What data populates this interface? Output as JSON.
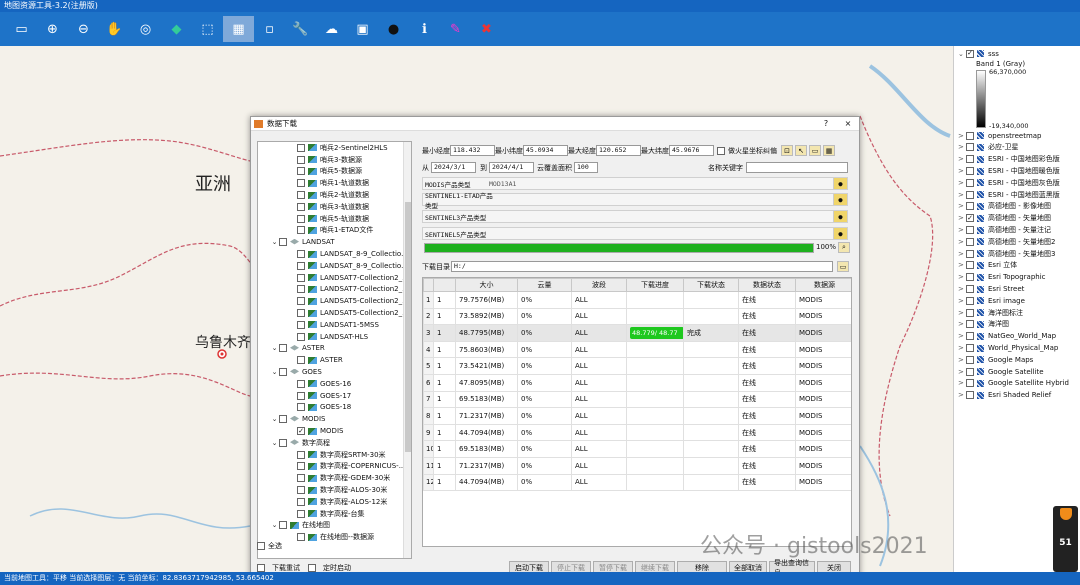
{
  "app": {
    "title": "地图资源工具-3.2(注册版)"
  },
  "toolbar": {
    "buttons": [
      "save",
      "zoom-in",
      "zoom-out",
      "pan",
      "zoom-extent",
      "navigate",
      "select-area",
      "grid",
      "clear",
      "tools",
      "cloud",
      "map",
      "user",
      "info",
      "edit",
      "close"
    ]
  },
  "map": {
    "labels": {
      "asia": "亚洲",
      "urumqi": "乌鲁木齐"
    }
  },
  "layers": {
    "items": [
      {
        "label": "sss",
        "checked": true,
        "expand": "⌄"
      },
      {
        "label": "openstreetmap",
        "checked": false,
        "expand": ">"
      },
      {
        "label": "必应-卫星",
        "checked": false,
        "expand": ">"
      },
      {
        "label": "ESRI - 中国地图彩色版",
        "checked": false,
        "expand": ">"
      },
      {
        "label": "ESRI - 中国地图暖色版",
        "checked": false,
        "expand": ">"
      },
      {
        "label": "ESRI - 中国地图灰色版",
        "checked": false,
        "expand": ">"
      },
      {
        "label": "ESRI - 中国地图蓝黑版",
        "checked": false,
        "expand": ">"
      },
      {
        "label": "高德地图 - 影像地图",
        "checked": false,
        "expand": ">"
      },
      {
        "label": "高德地图 - 矢量地图",
        "checked": true,
        "expand": ">"
      },
      {
        "label": "高德地图 - 矢量注记",
        "checked": false,
        "expand": ">"
      },
      {
        "label": "高德地图 - 矢量地图2",
        "checked": false,
        "expand": ">"
      },
      {
        "label": "高德地图 - 矢量地图3",
        "checked": false,
        "expand": ">"
      },
      {
        "label": "Esri 立体",
        "checked": false,
        "expand": ">"
      },
      {
        "label": "Esri Topographic",
        "checked": false,
        "expand": ">"
      },
      {
        "label": "Esri Street",
        "checked": false,
        "expand": ">"
      },
      {
        "label": "Esri image",
        "checked": false,
        "expand": ">"
      },
      {
        "label": "海洋图标注",
        "checked": false,
        "expand": ">"
      },
      {
        "label": "海洋图",
        "checked": false,
        "expand": ">"
      },
      {
        "label": "NatGeo_World_Map",
        "checked": false,
        "expand": ">"
      },
      {
        "label": "World_Physical_Map",
        "checked": false,
        "expand": ">"
      },
      {
        "label": "Google Maps",
        "checked": false,
        "expand": ">"
      },
      {
        "label": "Google Satellite",
        "checked": false,
        "expand": ">"
      },
      {
        "label": "Google Satellite Hybrid",
        "checked": false,
        "expand": ">"
      },
      {
        "label": "Esri Shaded Relief",
        "checked": false,
        "expand": ">"
      }
    ],
    "legend": {
      "band": "Band 1 (Gray)",
      "max": "66,370,000",
      "min": "-19,340,000"
    }
  },
  "dialog": {
    "title": "数据下载",
    "help": "?",
    "close": "×",
    "tree": [
      {
        "indent": 2,
        "chev": "",
        "icon": "leaf",
        "label": "哨兵2-Sentinel2HLS"
      },
      {
        "indent": 2,
        "chev": "",
        "icon": "leaf",
        "label": "哨兵3-数据源"
      },
      {
        "indent": 2,
        "chev": "",
        "icon": "leaf",
        "label": "哨兵5-数据源"
      },
      {
        "indent": 2,
        "chev": "",
        "icon": "leaf",
        "label": "哨兵1-轨道数据"
      },
      {
        "indent": 2,
        "chev": "",
        "icon": "leaf",
        "label": "哨兵2-轨道数据"
      },
      {
        "indent": 2,
        "chev": "",
        "icon": "leaf",
        "label": "哨兵3-轨道数据"
      },
      {
        "indent": 2,
        "chev": "",
        "icon": "leaf",
        "label": "哨兵5-轨道数据"
      },
      {
        "indent": 2,
        "chev": "",
        "icon": "leaf",
        "label": "哨兵1-ETAD文件"
      },
      {
        "indent": 1,
        "chev": "⌄",
        "icon": "folder",
        "label": "LANDSAT"
      },
      {
        "indent": 2,
        "chev": "",
        "icon": "leaf",
        "label": "LANDSAT_8-9_Collectio..."
      },
      {
        "indent": 2,
        "chev": "",
        "icon": "leaf",
        "label": "LANDSAT_8-9_Collectio..."
      },
      {
        "indent": 2,
        "chev": "",
        "icon": "leaf",
        "label": "LANDSAT7-Collection2_..."
      },
      {
        "indent": 2,
        "chev": "",
        "icon": "leaf",
        "label": "LANDSAT7-Collection2_..."
      },
      {
        "indent": 2,
        "chev": "",
        "icon": "leaf",
        "label": "LANDSAT5-Collection2_..."
      },
      {
        "indent": 2,
        "chev": "",
        "icon": "leaf",
        "label": "LANDSAT5-Collection2_..."
      },
      {
        "indent": 2,
        "chev": "",
        "icon": "leaf",
        "label": "LANDSAT1-5MSS"
      },
      {
        "indent": 2,
        "chev": "",
        "icon": "leaf",
        "label": "LANDSAT-HLS"
      },
      {
        "indent": 1,
        "chev": "⌄",
        "icon": "folder",
        "label": "ASTER"
      },
      {
        "indent": 2,
        "chev": "",
        "icon": "leaf",
        "label": "ASTER"
      },
      {
        "indent": 1,
        "chev": "⌄",
        "icon": "folder",
        "label": "GOES"
      },
      {
        "indent": 2,
        "chev": "",
        "icon": "leaf",
        "label": "GOES-16"
      },
      {
        "indent": 2,
        "chev": "",
        "icon": "leaf",
        "label": "GOES-17"
      },
      {
        "indent": 2,
        "chev": "",
        "icon": "leaf",
        "label": "GOES-18"
      },
      {
        "indent": 1,
        "chev": "⌄",
        "icon": "folder",
        "label": "MODIS"
      },
      {
        "indent": 2,
        "chev": "",
        "icon": "leaf",
        "label": "MODIS",
        "checked": true
      },
      {
        "indent": 1,
        "chev": "⌄",
        "icon": "folder",
        "label": "数字高程"
      },
      {
        "indent": 2,
        "chev": "",
        "icon": "leaf",
        "label": "数字高程SRTM-30米"
      },
      {
        "indent": 2,
        "chev": "",
        "icon": "leaf",
        "label": "数字高程-COPERNICUS-..."
      },
      {
        "indent": 2,
        "chev": "",
        "icon": "leaf",
        "label": "数字高程-GDEM-30米"
      },
      {
        "indent": 2,
        "chev": "",
        "icon": "leaf",
        "label": "数字高程-ALOS-30米"
      },
      {
        "indent": 2,
        "chev": "",
        "icon": "leaf",
        "label": "数字高程-ALOS-12米"
      },
      {
        "indent": 2,
        "chev": "",
        "icon": "leaf",
        "label": "数字高程-台集"
      },
      {
        "indent": 1,
        "chev": "⌄",
        "icon": "leaf",
        "label": "在线地图"
      },
      {
        "indent": 2,
        "chev": "",
        "icon": "leaf",
        "label": "在线地图--数据源"
      }
    ],
    "select_all": "全选",
    "bounds": {
      "min_lon_label": "最小经度",
      "min_lon": "118.432",
      "min_lat_label": "最小纬度",
      "min_lat": "45.0934",
      "max_lon_label": "最大经度",
      "max_lon": "120.652",
      "max_lat_label": "最大纬度",
      "max_lat": "45.9676",
      "spherical_label": "做火星坐标纠偏"
    },
    "dates": {
      "from_label": "从",
      "from": "2024/3/1",
      "to_label": "到",
      "to": "2024/4/1",
      "cloud_label": "云覆盖面积",
      "cloud": "100",
      "keyword_label": "名称关键字",
      "keyword": ""
    },
    "products": [
      {
        "label": "MODIS产品类型",
        "value": "MOD13A1"
      },
      {
        "label": "SENTINEL1-ETAD产品类型",
        "value": ""
      },
      {
        "label": "SENTINEL3产品类型",
        "value": ""
      },
      {
        "label": "SENTINEL5产品类型",
        "value": ""
      }
    ],
    "progress": {
      "value": 100,
      "text": "100%"
    },
    "download_dir": {
      "label": "下载目录",
      "value": "H:/"
    },
    "table": {
      "headers": [
        "",
        "",
        "大小",
        "云量",
        "波段",
        "下载进度",
        "下载状态",
        "数据状态",
        "数据源"
      ],
      "rows": [
        {
          "n": "1",
          "c": "1",
          "size": "79.7576(MB)",
          "cloud": "0%",
          "band": "ALL",
          "progress": "",
          "status": "",
          "data": "在线",
          "src": "MODIS"
        },
        {
          "n": "2",
          "c": "1",
          "size": "73.5892(MB)",
          "cloud": "0%",
          "band": "ALL",
          "progress": "",
          "status": "",
          "data": "在线",
          "src": "MODIS"
        },
        {
          "n": "3",
          "c": "1",
          "size": "48.7795(MB)",
          "cloud": "0%",
          "band": "ALL",
          "progress": "48.779/  48.77",
          "status": "完成",
          "data": "在线",
          "src": "MODIS",
          "selected": true
        },
        {
          "n": "4",
          "c": "1",
          "size": "75.8603(MB)",
          "cloud": "0%",
          "band": "ALL",
          "progress": "",
          "status": "",
          "data": "在线",
          "src": "MODIS"
        },
        {
          "n": "5",
          "c": "1",
          "size": "73.5421(MB)",
          "cloud": "0%",
          "band": "ALL",
          "progress": "",
          "status": "",
          "data": "在线",
          "src": "MODIS"
        },
        {
          "n": "6",
          "c": "1",
          "size": "47.8095(MB)",
          "cloud": "0%",
          "band": "ALL",
          "progress": "",
          "status": "",
          "data": "在线",
          "src": "MODIS"
        },
        {
          "n": "7",
          "c": "1",
          "size": "69.5183(MB)",
          "cloud": "0%",
          "band": "ALL",
          "progress": "",
          "status": "",
          "data": "在线",
          "src": "MODIS"
        },
        {
          "n": "8",
          "c": "1",
          "size": "71.2317(MB)",
          "cloud": "0%",
          "band": "ALL",
          "progress": "",
          "status": "",
          "data": "在线",
          "src": "MODIS"
        },
        {
          "n": "9",
          "c": "1",
          "size": "44.7094(MB)",
          "cloud": "0%",
          "band": "ALL",
          "progress": "",
          "status": "",
          "data": "在线",
          "src": "MODIS"
        },
        {
          "n": "10",
          "c": "1",
          "size": "69.5183(MB)",
          "cloud": "0%",
          "band": "ALL",
          "progress": "",
          "status": "",
          "data": "在线",
          "src": "MODIS"
        },
        {
          "n": "11",
          "c": "1",
          "size": "71.2317(MB)",
          "cloud": "0%",
          "band": "ALL",
          "progress": "",
          "status": "",
          "data": "在线",
          "src": "MODIS"
        },
        {
          "n": "12",
          "c": "1",
          "size": "44.7094(MB)",
          "cloud": "0%",
          "band": "ALL",
          "progress": "",
          "status": "",
          "data": "在线",
          "src": "MODIS"
        }
      ]
    },
    "options": {
      "retry": "下载重试",
      "timer": "定时启动"
    },
    "buttons": {
      "start": "启动下载",
      "stop": "停止下载",
      "pause": "暂停下载",
      "resume": "继续下载",
      "remove": "移除",
      "cancel_all": "全部取消",
      "export": "导出查询信息",
      "close": "关闭"
    }
  },
  "statusbar": {
    "text": "当前地图工具：平移   当前选择图层：无   当前坐标：82.8363717942985, 53.665402"
  },
  "watermark": "公众号 · gistools2021",
  "perf": {
    "percent": "51"
  }
}
